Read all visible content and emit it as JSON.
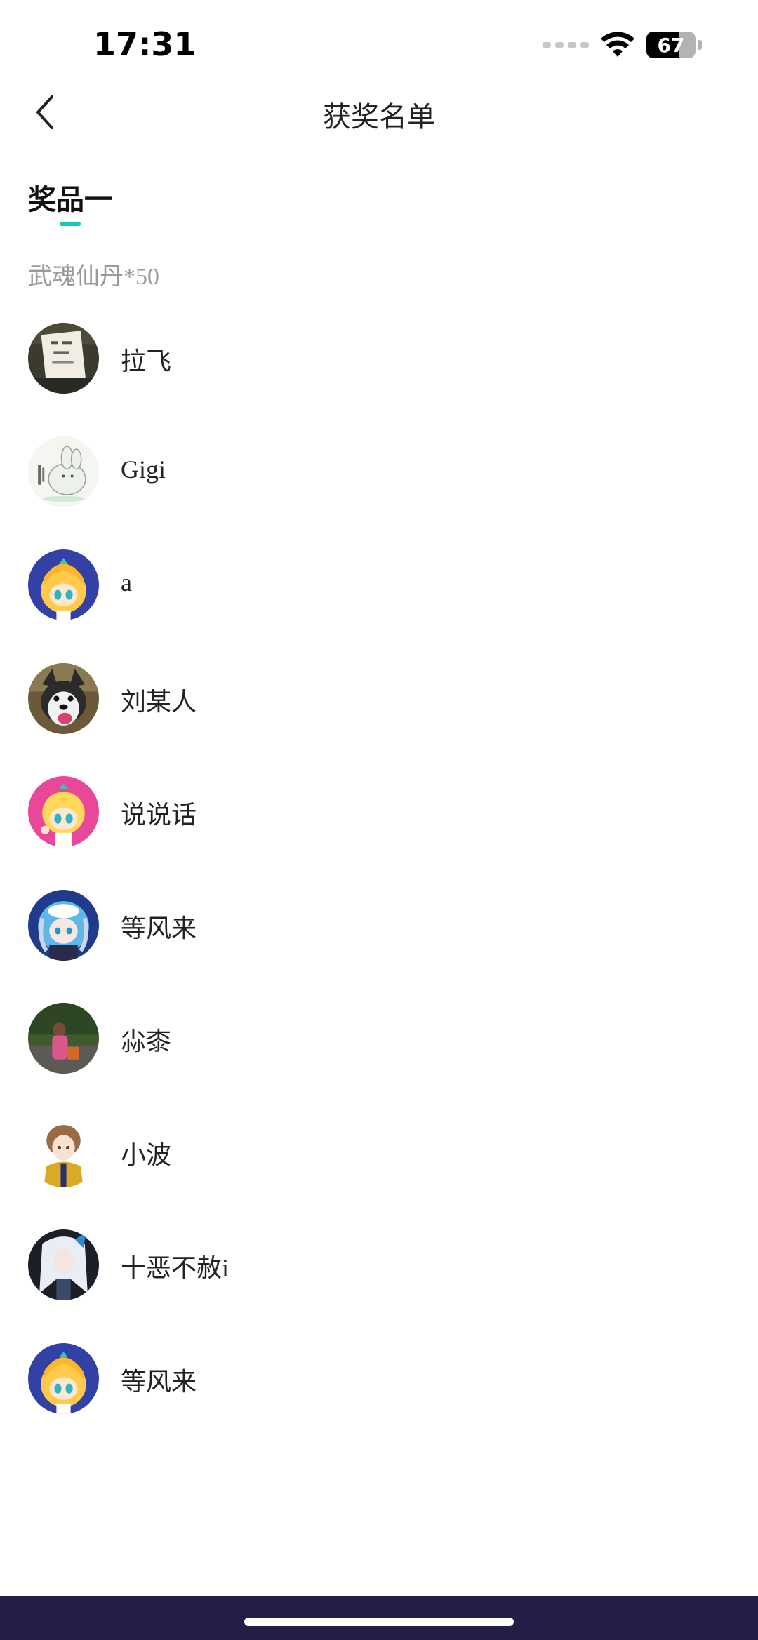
{
  "status_bar": {
    "time": "17:31",
    "battery_level": "67",
    "battery_fraction": 0.67,
    "icons": [
      "cellular-icon",
      "wifi-icon",
      "battery-icon"
    ]
  },
  "nav": {
    "title": "获奖名单",
    "back_icon": "chevron-left-icon"
  },
  "tab": {
    "label": "奖品一",
    "accent_color": "#19c7b8"
  },
  "prize": {
    "description": "武魂仙丹*50"
  },
  "winners": [
    {
      "name": "拉飞",
      "avatar": "photo-card-avatar"
    },
    {
      "name": "Gigi",
      "avatar": "sketch-rabbit-avatar"
    },
    {
      "name": "a",
      "avatar": "cartoon-girl-blue-avatar"
    },
    {
      "name": "刘某人",
      "avatar": "husky-dog-avatar"
    },
    {
      "name": "说说话",
      "avatar": "cartoon-girl-pink-avatar"
    },
    {
      "name": "等风来",
      "avatar": "anime-character-avatar"
    },
    {
      "name": "尛桼",
      "avatar": "outdoor-child-photo-avatar"
    },
    {
      "name": "小波",
      "avatar": "anime-girl-uniform-avatar"
    },
    {
      "name": "十恶不赦i",
      "avatar": "anime-white-hair-avatar"
    },
    {
      "name": "等风来",
      "avatar": "cartoon-girl-blue-avatar"
    }
  ],
  "colors": {
    "bottom_bar": "#221e45",
    "accent": "#19c7b8"
  }
}
